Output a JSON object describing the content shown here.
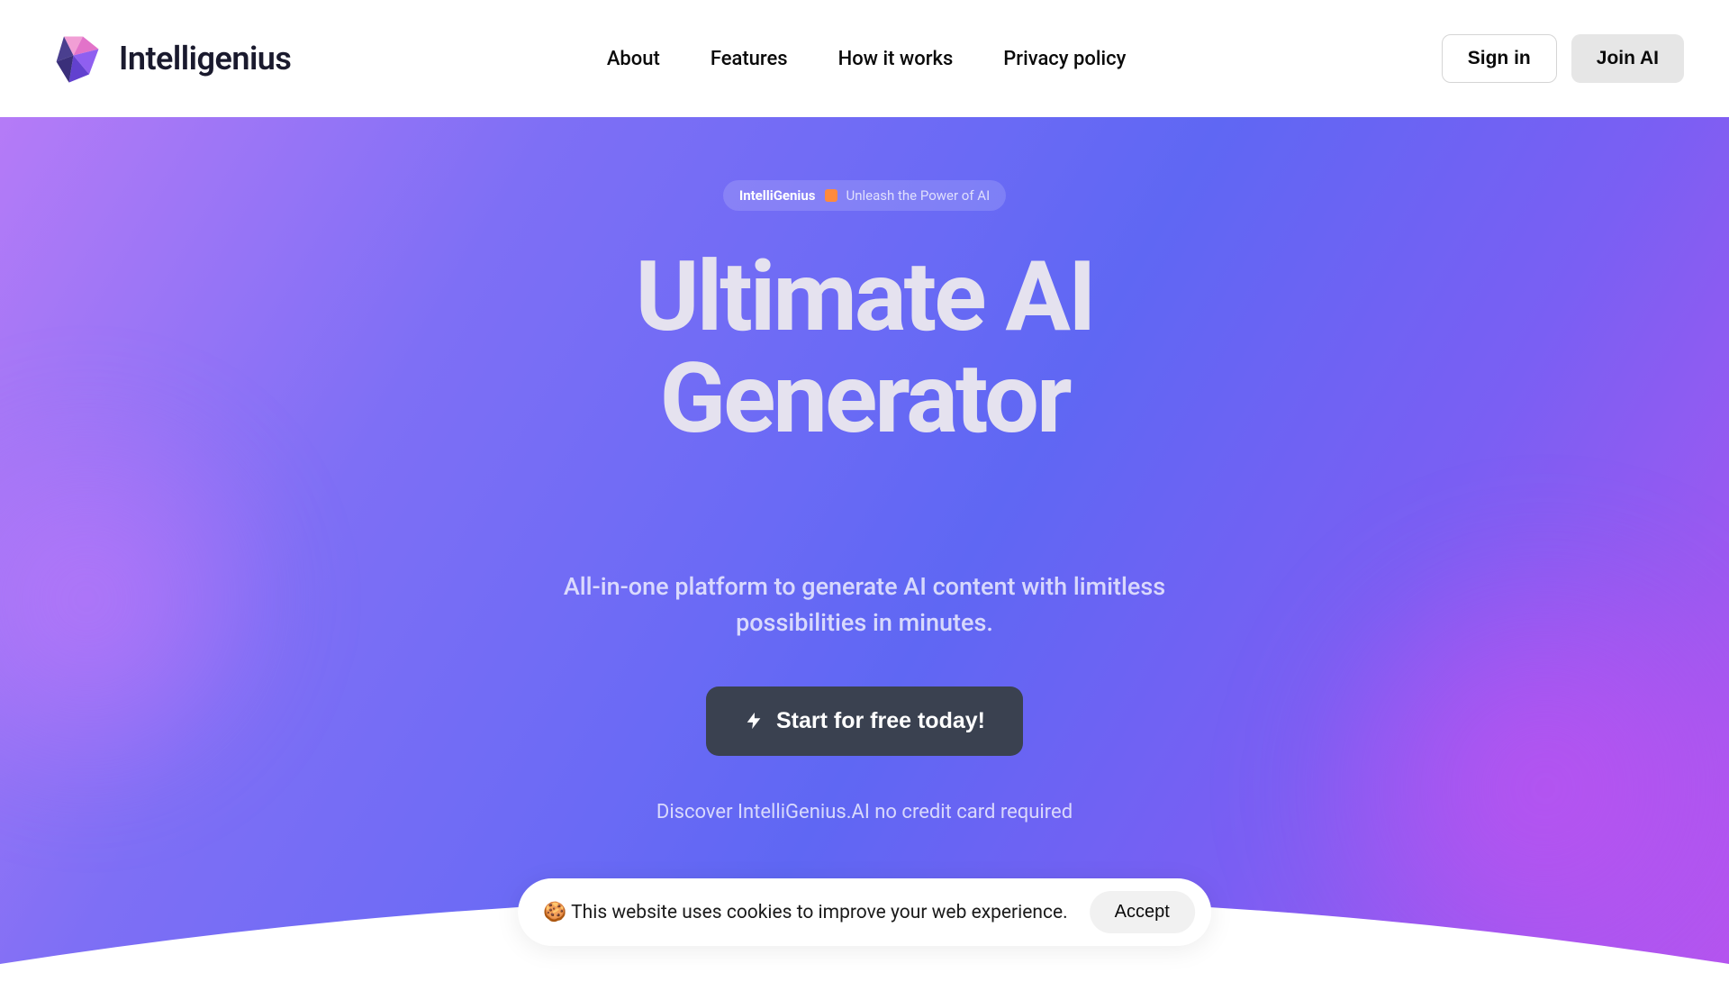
{
  "header": {
    "logo_text": "Intelligenius",
    "nav": [
      {
        "label": "About"
      },
      {
        "label": "Features"
      },
      {
        "label": "How it works"
      },
      {
        "label": "Privacy policy"
      }
    ],
    "signin_label": "Sign in",
    "join_label": "Join AI"
  },
  "hero": {
    "badge_brand": "IntelliGenius",
    "badge_tagline": "Unleash the Power of AI",
    "heading": "Ultimate AI Generator",
    "subheading": "All-in-one platform to generate AI content with limitless possibilities in minutes.",
    "cta_label": "Start for free today!",
    "disclaimer": "Discover IntelliGenius.AI no credit card required"
  },
  "cookie": {
    "text": "🍪 This website uses cookies to improve your web experience.",
    "accept_label": "Accept"
  },
  "colors": {
    "accent_gradient_start": "#b57bf7",
    "accent_gradient_end": "#b455ef",
    "cta_bg": "#3a4150"
  }
}
